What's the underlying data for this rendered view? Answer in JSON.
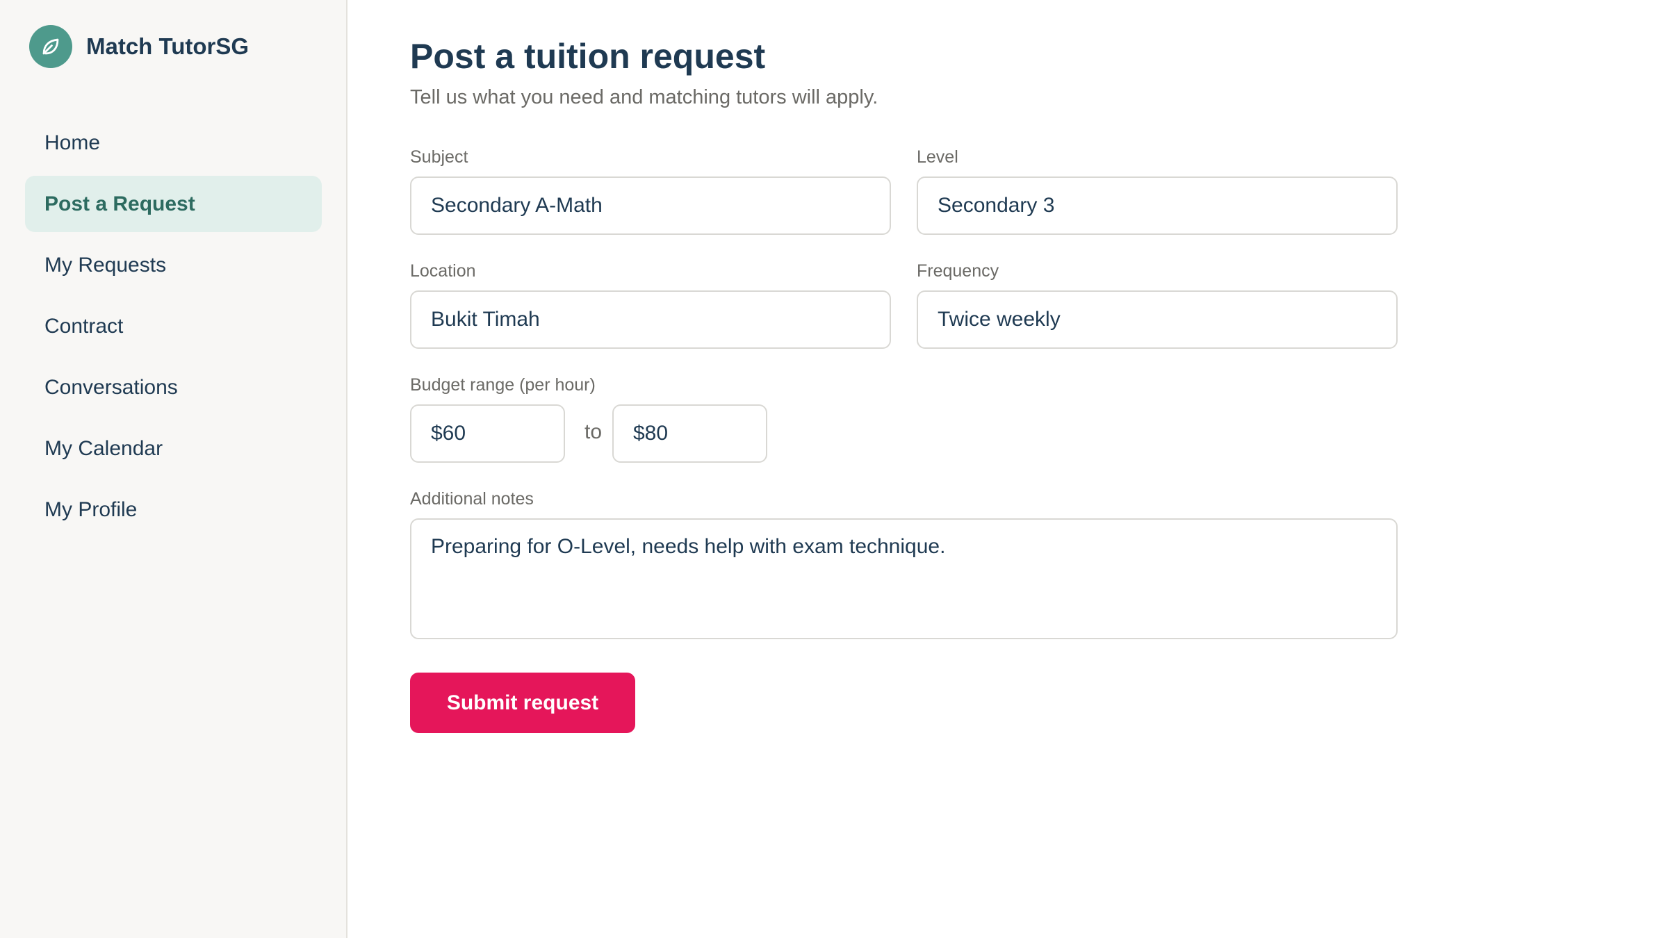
{
  "brand": {
    "name": "Match TutorSG",
    "logo_icon": "leaf-icon",
    "logo_color": "#4e9a8c"
  },
  "sidebar": {
    "items": [
      {
        "label": "Home",
        "active": false
      },
      {
        "label": "Post a Request",
        "active": true
      },
      {
        "label": "My Requests",
        "active": false
      },
      {
        "label": "Contract",
        "active": false
      },
      {
        "label": "Conversations",
        "active": false
      },
      {
        "label": "My Calendar",
        "active": false
      },
      {
        "label": "My Profile",
        "active": false
      }
    ]
  },
  "page": {
    "title": "Post a tuition request",
    "subtitle": "Tell us what you need and matching tutors will apply."
  },
  "form": {
    "subject": {
      "label": "Subject",
      "value": "Secondary A-Math"
    },
    "level": {
      "label": "Level",
      "value": "Secondary 3"
    },
    "location": {
      "label": "Location",
      "value": "Bukit Timah"
    },
    "frequency": {
      "label": "Frequency",
      "value": "Twice weekly"
    },
    "budget": {
      "label": "Budget range (per hour)",
      "min": "$60",
      "separator": "to",
      "max": "$80"
    },
    "notes": {
      "label": "Additional notes",
      "value": "Preparing for O-Level, needs help with exam technique."
    },
    "submit_label": "Submit request"
  },
  "colors": {
    "accent": "#e5165a",
    "active_nav_bg": "#e1efeb",
    "active_nav_text": "#2d6b60",
    "text": "#1f3a52"
  }
}
